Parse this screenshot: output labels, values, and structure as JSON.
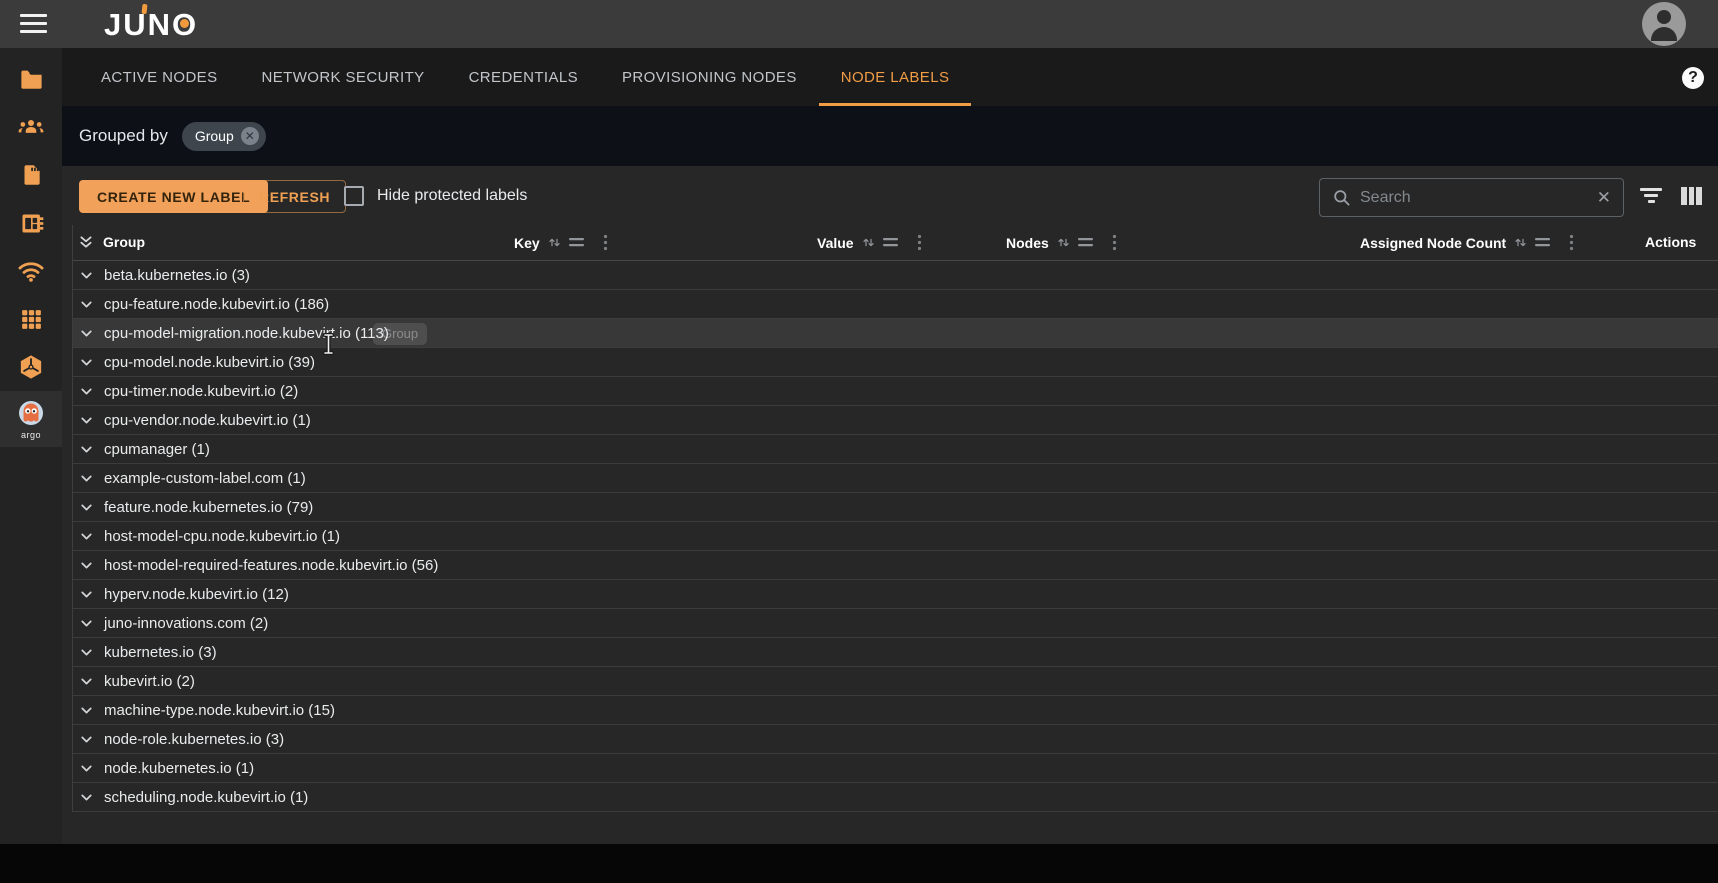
{
  "app": {
    "logo_text": "JUNO"
  },
  "topbar": {
    "hamburger": "menu-icon",
    "avatar": "user-avatar"
  },
  "sidebar": {
    "icons": [
      "folder",
      "groups",
      "sim-card",
      "memory-chip",
      "wifi",
      "apps-grid",
      "package-cube",
      "argo"
    ],
    "argo_label": "argo"
  },
  "tabs": [
    {
      "label": "ACTIVE NODES",
      "active": false
    },
    {
      "label": "NETWORK SECURITY",
      "active": false
    },
    {
      "label": "CREDENTIALS",
      "active": false
    },
    {
      "label": "PROVISIONING NODES",
      "active": false
    },
    {
      "label": "NODE LABELS",
      "active": true
    }
  ],
  "help": {
    "glyph": "?"
  },
  "grouped_bar": {
    "label": "Grouped by",
    "chip_label": "Group",
    "chip_close": "✕"
  },
  "toolbar": {
    "create_button": "CREATE NEW LABEL",
    "refresh_button": "REFRESH",
    "hide_protected_label": "Hide protected labels",
    "hide_protected_checked": false,
    "search_placeholder": "Search",
    "search_value": "",
    "clear_glyph": "✕"
  },
  "table": {
    "group_column": "Group",
    "columns": [
      "Key",
      "Value",
      "Nodes",
      "Assigned Node Count"
    ],
    "actions_column": "Actions",
    "hover_tooltip": "Group",
    "groups": [
      {
        "name": "beta.kubernetes.io",
        "count": 3
      },
      {
        "name": "cpu-feature.node.kubevirt.io",
        "count": 186
      },
      {
        "name": "cpu-model-migration.node.kubevirt.io",
        "count": 113,
        "hovered": true
      },
      {
        "name": "cpu-model.node.kubevirt.io",
        "count": 39
      },
      {
        "name": "cpu-timer.node.kubevirt.io",
        "count": 2
      },
      {
        "name": "cpu-vendor.node.kubevirt.io",
        "count": 1
      },
      {
        "name": "cpumanager",
        "count": 1
      },
      {
        "name": "example-custom-label.com",
        "count": 1
      },
      {
        "name": "feature.node.kubernetes.io",
        "count": 79
      },
      {
        "name": "host-model-cpu.node.kubevirt.io",
        "count": 1
      },
      {
        "name": "host-model-required-features.node.kubevirt.io",
        "count": 56
      },
      {
        "name": "hyperv.node.kubevirt.io",
        "count": 12
      },
      {
        "name": "juno-innovations.com",
        "count": 2
      },
      {
        "name": "kubernetes.io",
        "count": 3
      },
      {
        "name": "kubevirt.io",
        "count": 2
      },
      {
        "name": "machine-type.node.kubevirt.io",
        "count": 15
      },
      {
        "name": "node-role.kubernetes.io",
        "count": 3
      },
      {
        "name": "node.kubernetes.io",
        "count": 1
      },
      {
        "name": "scheduling.node.kubevirt.io",
        "count": 1
      }
    ]
  },
  "colors": {
    "accent_orange": "#F2A15B",
    "active_tab_orange": "#F09D45",
    "topbar_bg": "#3B3B3B",
    "tabsbar_bg": "#1A1A1A",
    "grouped_bar_bg": "#0D1117",
    "content_bg": "#272727",
    "row_divider": "#3C3C3C",
    "hover_row_bg": "#383838"
  }
}
